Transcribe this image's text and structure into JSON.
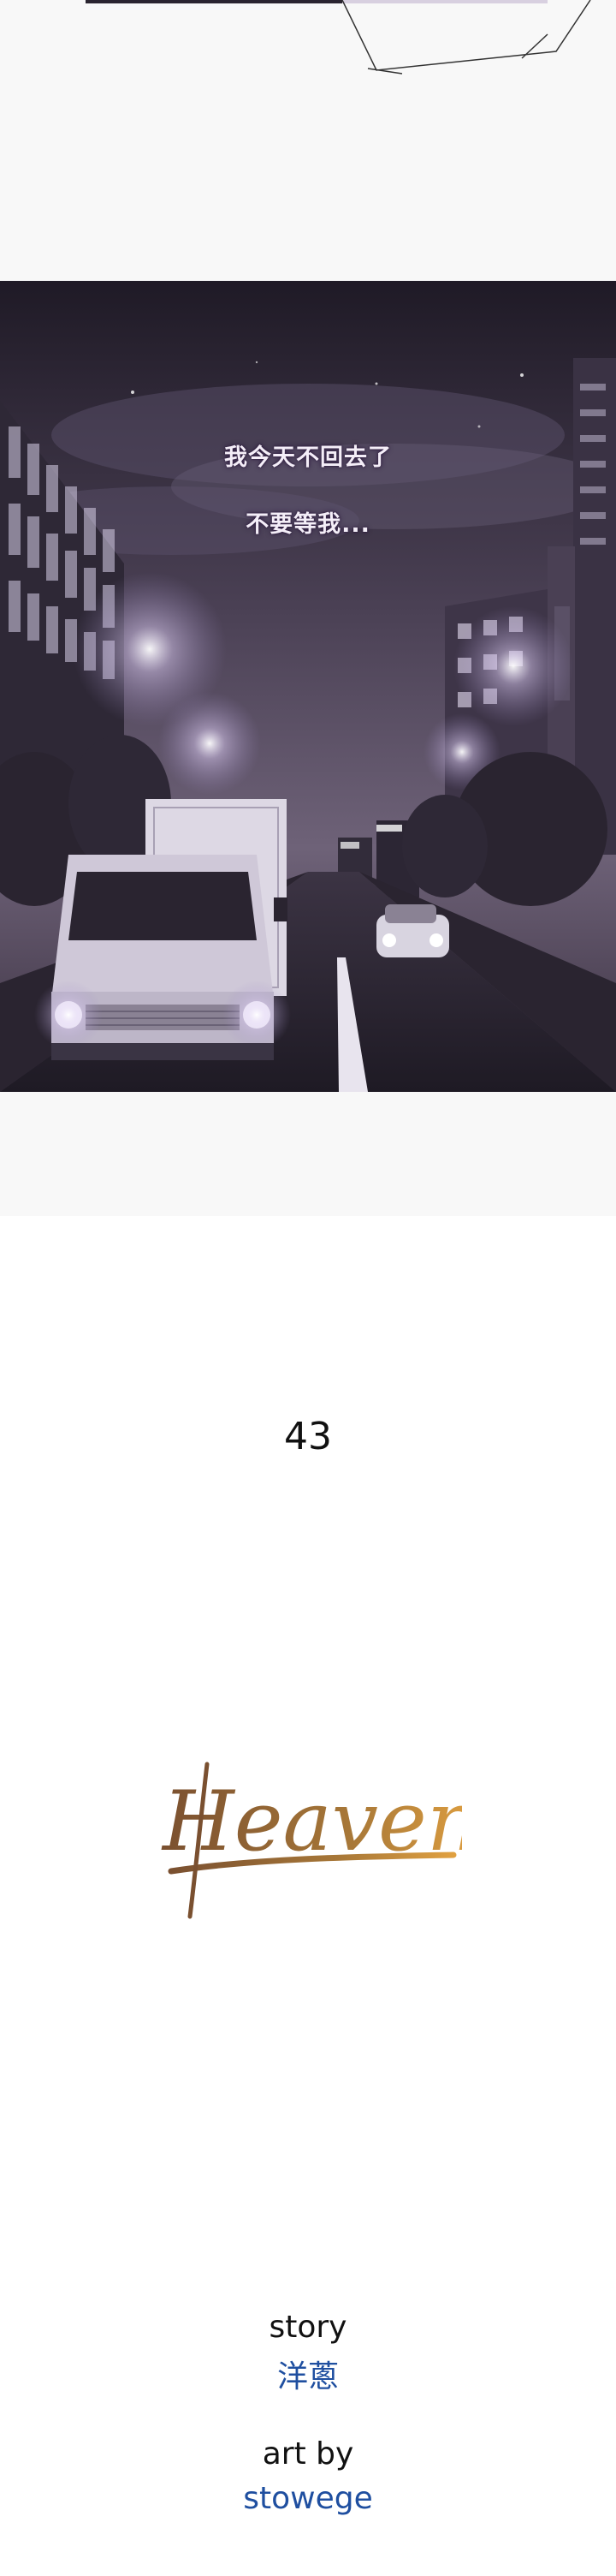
{
  "panel_night": {
    "dialogue": [
      "我今天不回去了",
      "不要等我..."
    ]
  },
  "chapter": {
    "number": "43"
  },
  "logo": {
    "text": "Heaven"
  },
  "credits": {
    "story_label": "story",
    "story_name": "洋蔥",
    "art_label": "art by",
    "art_name": "stowege"
  }
}
